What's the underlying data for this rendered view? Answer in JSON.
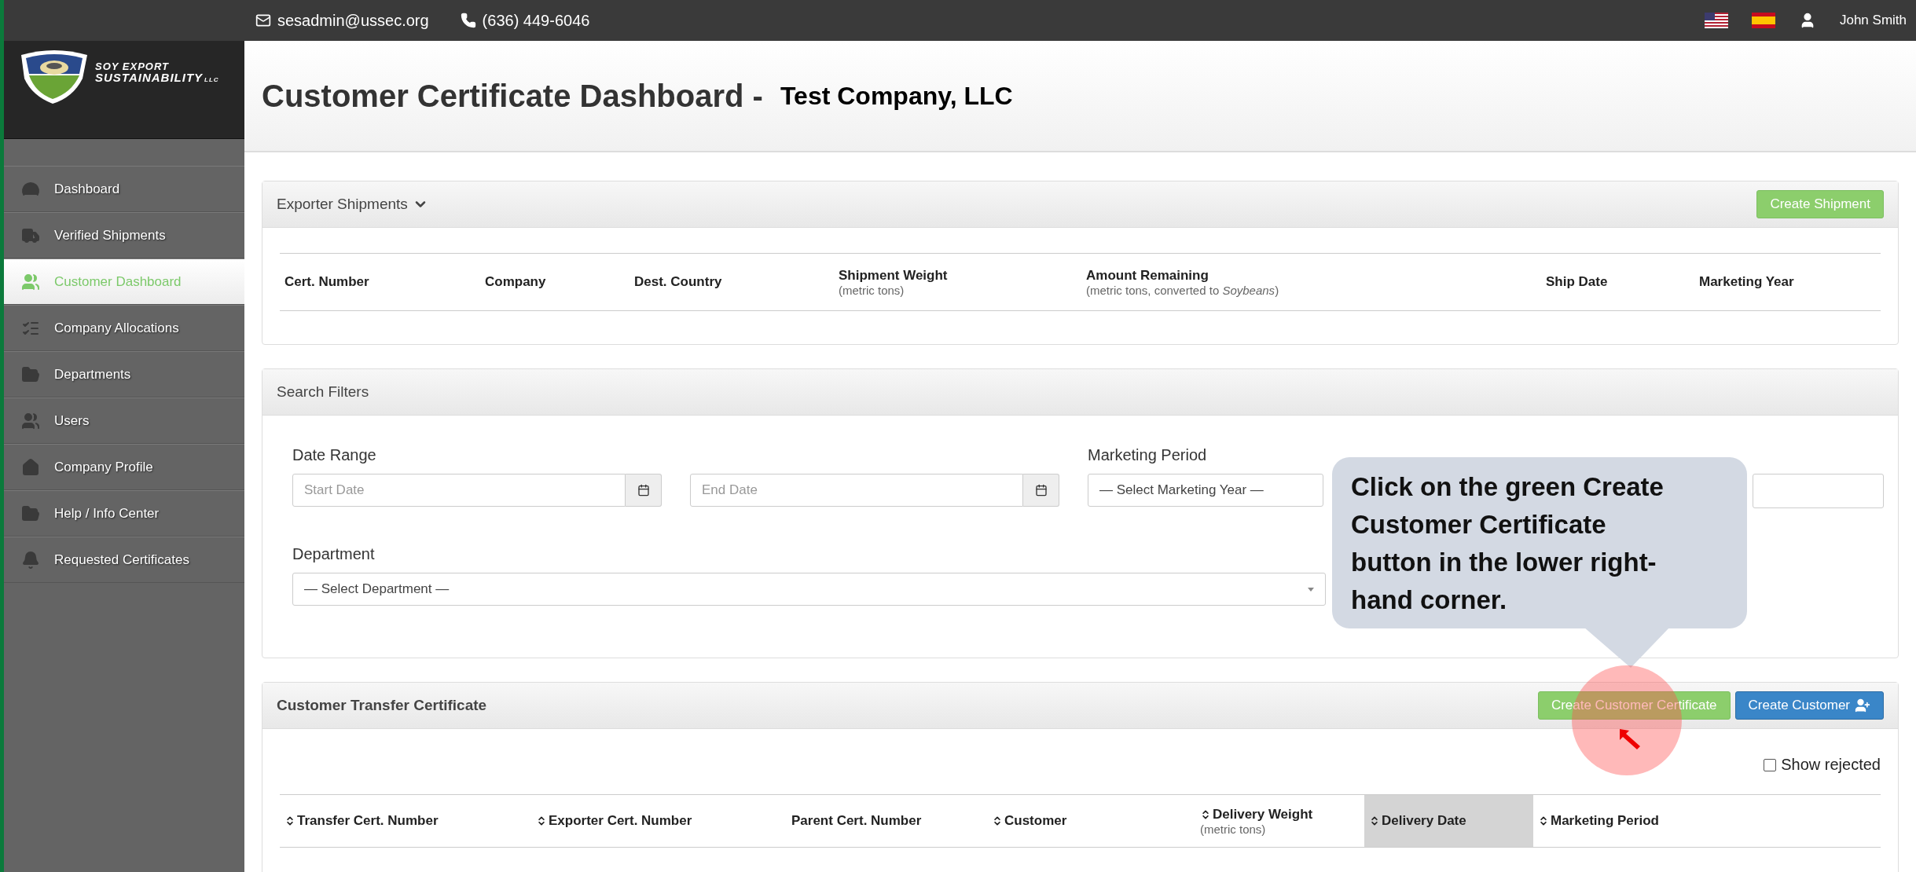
{
  "topbar": {
    "email": "sesadmin@ussec.org",
    "phone": "(636) 449-6046",
    "user": "John Smith"
  },
  "logo": {
    "line1": "SOY EXPORT",
    "line2": "SUSTAINABILITY",
    "suffix": "LLC"
  },
  "sidebar": {
    "items": [
      {
        "label": "Dashboard",
        "selected": false
      },
      {
        "label": "Verified Shipments",
        "selected": false
      },
      {
        "label": "Customer Dashboard",
        "selected": true
      },
      {
        "label": "Company Allocations",
        "selected": false
      },
      {
        "label": "Departments",
        "selected": false
      },
      {
        "label": "Users",
        "selected": false
      },
      {
        "label": "Company Profile",
        "selected": false
      },
      {
        "label": "Help / Info Center",
        "selected": false
      },
      {
        "label": "Requested Certificates",
        "selected": false
      }
    ]
  },
  "header": {
    "title": "Customer Certificate Dashboard -",
    "company": "Test Company, LLC"
  },
  "exporter_shipments": {
    "title": "Exporter Shipments",
    "button": "Create Shipment",
    "columns": [
      {
        "label": "Cert. Number"
      },
      {
        "label": "Company"
      },
      {
        "label": "Dest. Country"
      },
      {
        "label": "Shipment Weight",
        "sub": "(metric tons)"
      },
      {
        "label": "Amount Remaining",
        "sub": "(metric tons, converted to *Soybeans*)"
      },
      {
        "label": "Ship Date"
      },
      {
        "label": "Marketing Year"
      }
    ]
  },
  "search_filters": {
    "title": "Search Filters",
    "date_range_label": "Date Range",
    "start_placeholder": "Start Date",
    "end_placeholder": "End Date",
    "marketing_period_label": "Marketing Period",
    "marketing_select": "— Select Marketing Year —",
    "department_label": "Department",
    "department_select": "— Select Department —"
  },
  "customer_transfer": {
    "title": "Customer Transfer Certificate",
    "buttons": [
      {
        "label": "Create Customer Certificate",
        "kind": "success"
      },
      {
        "label": "Create Customer",
        "kind": "primary"
      }
    ],
    "show_rejected": {
      "label": "Show rejected",
      "checked": false
    },
    "columns": [
      {
        "label": "Transfer Cert. Number",
        "sortable": true,
        "selected": false
      },
      {
        "label": "Exporter Cert. Number",
        "sortable": true,
        "selected": false
      },
      {
        "label": "Parent Cert. Number",
        "sortable": false,
        "selected": false
      },
      {
        "label": "Customer",
        "sortable": true,
        "selected": false
      },
      {
        "label": "Delivery Weight",
        "sub": "(metric tons)",
        "sortable": true,
        "selected": false
      },
      {
        "label": "Delivery Date",
        "sortable": true,
        "selected": true
      },
      {
        "label": "Marketing Period",
        "sortable": true,
        "selected": false
      }
    ]
  },
  "callout": {
    "text": "Click on the green Create Customer Certificate button in the lower right-hand corner."
  }
}
